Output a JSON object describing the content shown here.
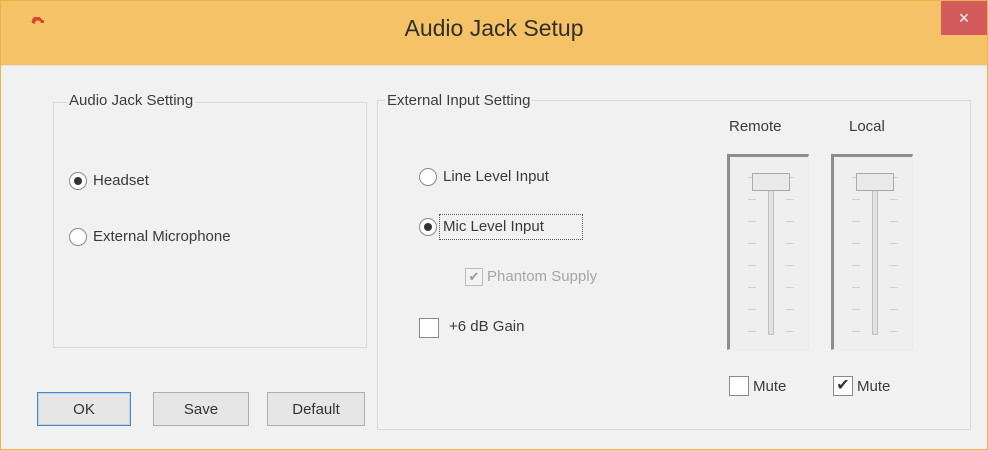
{
  "window": {
    "title": "Audio Jack Setup",
    "close_glyph": "×",
    "app_icon": "app-icon",
    "accent": "#f6c267"
  },
  "audio_jack": {
    "label": "Audio Jack Setting",
    "options": [
      {
        "label": "Headset",
        "checked": true
      },
      {
        "label": "External Microphone",
        "checked": false
      }
    ]
  },
  "external_input": {
    "label": "External Input Setting",
    "options": [
      {
        "label": "Line Level Input",
        "checked": false
      },
      {
        "label": "Mic Level Input",
        "checked": true
      }
    ],
    "phantom_supply": {
      "label": "Phantom Supply",
      "checked": true,
      "disabled": true
    },
    "gain": {
      "label": "+6 dB Gain",
      "checked": false
    }
  },
  "sliders": {
    "remote": {
      "label": "Remote",
      "level": 1.0,
      "mute_label": "Mute",
      "mute_checked": false
    },
    "local": {
      "label": "Local",
      "level": 1.0,
      "mute_label": "Mute",
      "mute_checked": true
    }
  },
  "buttons": {
    "ok": "OK",
    "save": "Save",
    "default": "Default"
  },
  "checkmark": "✔"
}
